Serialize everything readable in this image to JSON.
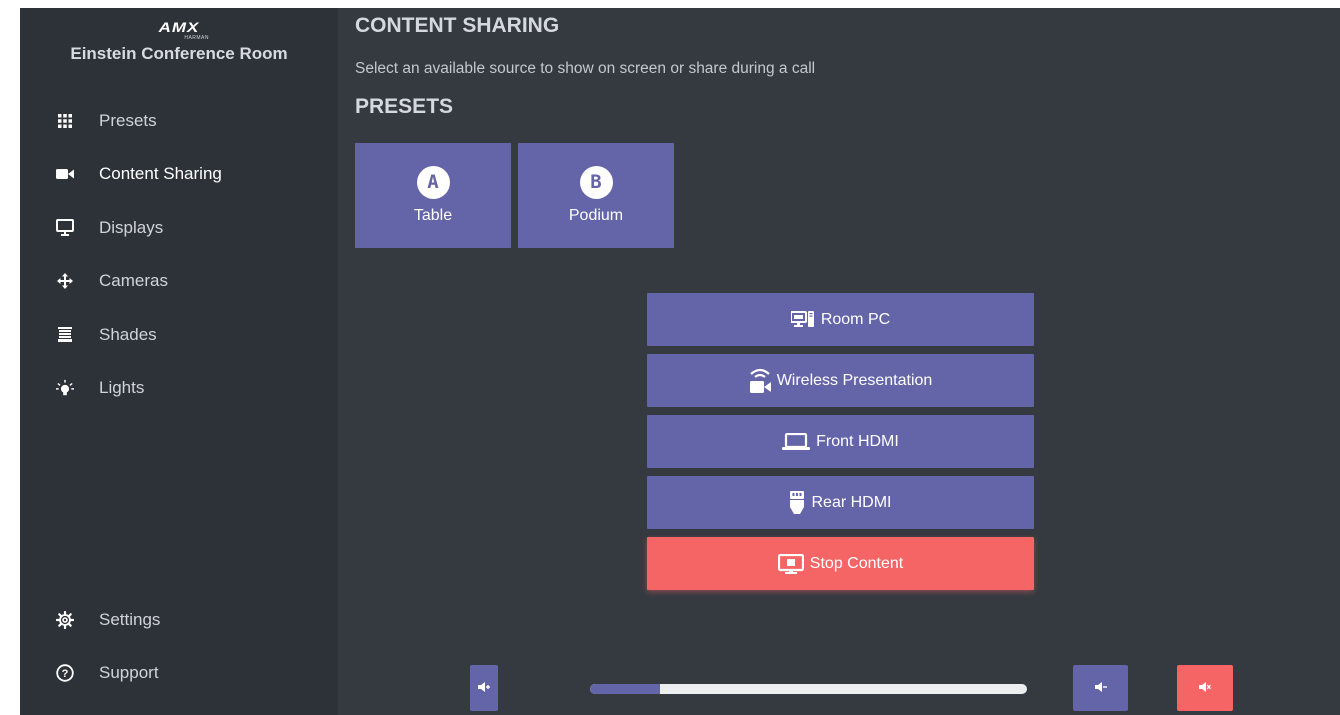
{
  "brand": {
    "logo_text": "AMX",
    "logo_subtext": "HARMAN",
    "room_name": "Einstein Conference Room"
  },
  "sidebar": {
    "items": [
      {
        "label": "Presets",
        "icon": "grid-icon",
        "active": false
      },
      {
        "label": "Content Sharing",
        "icon": "video-camera-icon",
        "active": true
      },
      {
        "label": "Displays",
        "icon": "monitor-icon",
        "active": false
      },
      {
        "label": "Cameras",
        "icon": "move-arrows-icon",
        "active": false
      },
      {
        "label": "Shades",
        "icon": "shades-icon",
        "active": false
      },
      {
        "label": "Lights",
        "icon": "lightbulb-icon",
        "active": false
      }
    ],
    "footer": [
      {
        "label": "Settings",
        "icon": "gear-icon"
      },
      {
        "label": "Support",
        "icon": "question-circle-icon"
      }
    ]
  },
  "main": {
    "title": "CONTENT SHARING",
    "subtitle": "Select an available source to show on screen or share during a call",
    "presets_title": "PRESETS",
    "presets": [
      {
        "badge": "A",
        "label": "Table"
      },
      {
        "badge": "B",
        "label": "Podium"
      }
    ],
    "sources": [
      {
        "label": "Room PC",
        "icon": "desktop-pc-icon"
      },
      {
        "label": "Wireless Presentation",
        "icon": "wireless-camera-icon"
      },
      {
        "label": "Front HDMI",
        "icon": "laptop-icon"
      },
      {
        "label": "Rear HDMI",
        "icon": "hdmi-plug-icon"
      },
      {
        "label": "Stop Content",
        "icon": "stop-screen-icon"
      }
    ]
  },
  "volume": {
    "level": 0.16,
    "buttons": [
      "volume-up-icon",
      "volume-down-icon",
      "volume-mute-icon"
    ]
  },
  "colors": {
    "background": "#343a40",
    "sidebar": "#2d3238",
    "accent": "#6464a8",
    "danger": "#f56565",
    "text": "#d5d9de"
  }
}
